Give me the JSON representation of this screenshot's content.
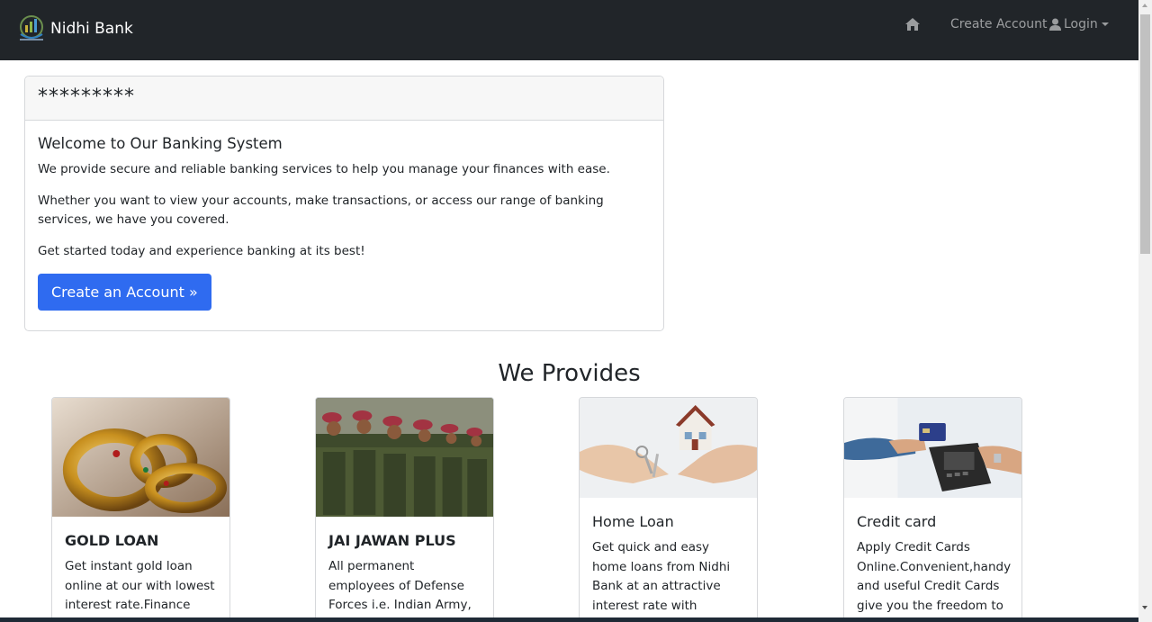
{
  "navbar": {
    "brand": "Nidhi Bank",
    "links": {
      "home_icon": "home-icon",
      "create_account": "Create Account",
      "login": "Login"
    }
  },
  "welcome": {
    "header": "*********",
    "title": "Welcome to Our Banking System",
    "paragraphs": [
      "We provide secure and reliable banking services to help you manage your finances with ease.",
      "Whether you want to view your accounts, make transactions, or access our range of banking services, we have you covered.",
      "Get started today and experience banking at its best!"
    ],
    "cta": "Create an Account »"
  },
  "section": {
    "title": "We Provides"
  },
  "products": [
    {
      "title": "GOLD LOAN",
      "text": "Get instant gold loan online at our with lowest interest rate.Finance your"
    },
    {
      "title": "JAI JAWAN PLUS",
      "text": "All permanent employees of Defense Forces i.e. Indian Army, Indian Air"
    },
    {
      "title": "Home Loan",
      "text": "Get quick and easy home loans from Nidhi Bank at an attractive interest rate with minimal"
    },
    {
      "title": "Credit card",
      "text": "Apply Credit Cards Online.Convenient,handy and useful Credit Cards give you the freedom to"
    }
  ],
  "colors": {
    "navbar_bg": "#212529",
    "primary": "#2f6bf0"
  }
}
